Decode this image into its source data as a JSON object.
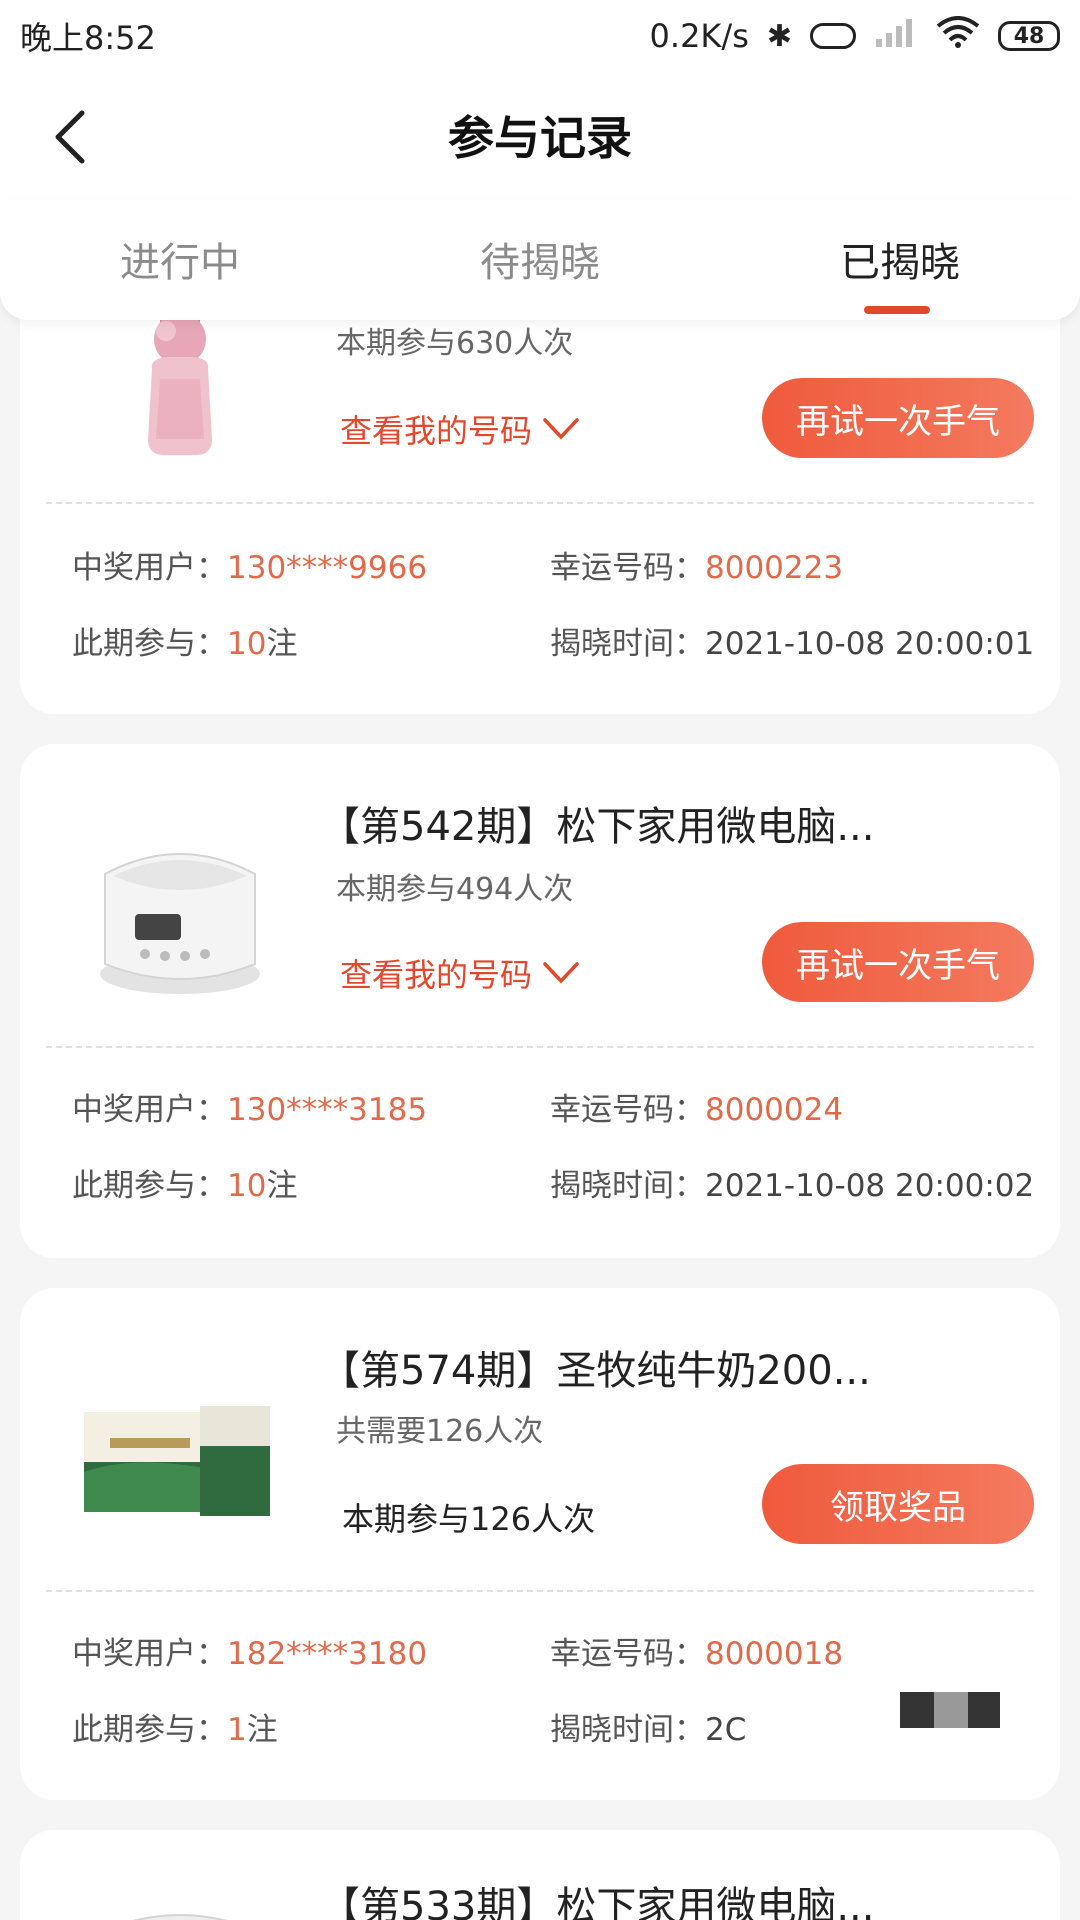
{
  "status": {
    "time": "晚上8:52",
    "speed": "0.2K/s",
    "battery": "48"
  },
  "header": {
    "title": "参与记录"
  },
  "tabs": [
    {
      "label": "进行中"
    },
    {
      "label": "待揭晓"
    },
    {
      "label": "已揭晓"
    }
  ],
  "active_tab": "已揭晓",
  "labels": {
    "my_numbers": "查看我的号码",
    "winner": "中奖用户：",
    "lucky": "幸运号码：",
    "joined": "此期参与：",
    "reveal_time": "揭晓时间：",
    "unit": "注"
  },
  "records": [
    {
      "participants": "本期参与630人次",
      "button": "再试一次手气",
      "winner": "130****9966",
      "lucky": "8000223",
      "joined": "10",
      "reveal_time": "2021-10-08 20:00:01"
    },
    {
      "title": "【第542期】松下家用微电脑...",
      "participants": "本期参与494人次",
      "button": "再试一次手气",
      "winner": "130****3185",
      "lucky": "8000024",
      "joined": "10",
      "reveal_time": "2021-10-08 20:00:02"
    },
    {
      "title": "【第574期】圣牧纯牛奶200...",
      "participants": "共需要126人次",
      "joined_text": "本期参与126人次",
      "button": "领取奖品",
      "winner": "182****3180",
      "lucky": "8000018",
      "joined": "1",
      "reveal_time": "2C"
    },
    {
      "title": "【第533期】松下家用微电脑..."
    }
  ],
  "colors": {
    "accent": "#e2482b",
    "button_start": "#ef5a3c",
    "button_end": "#f47a5f",
    "value": "#e06a4a"
  }
}
